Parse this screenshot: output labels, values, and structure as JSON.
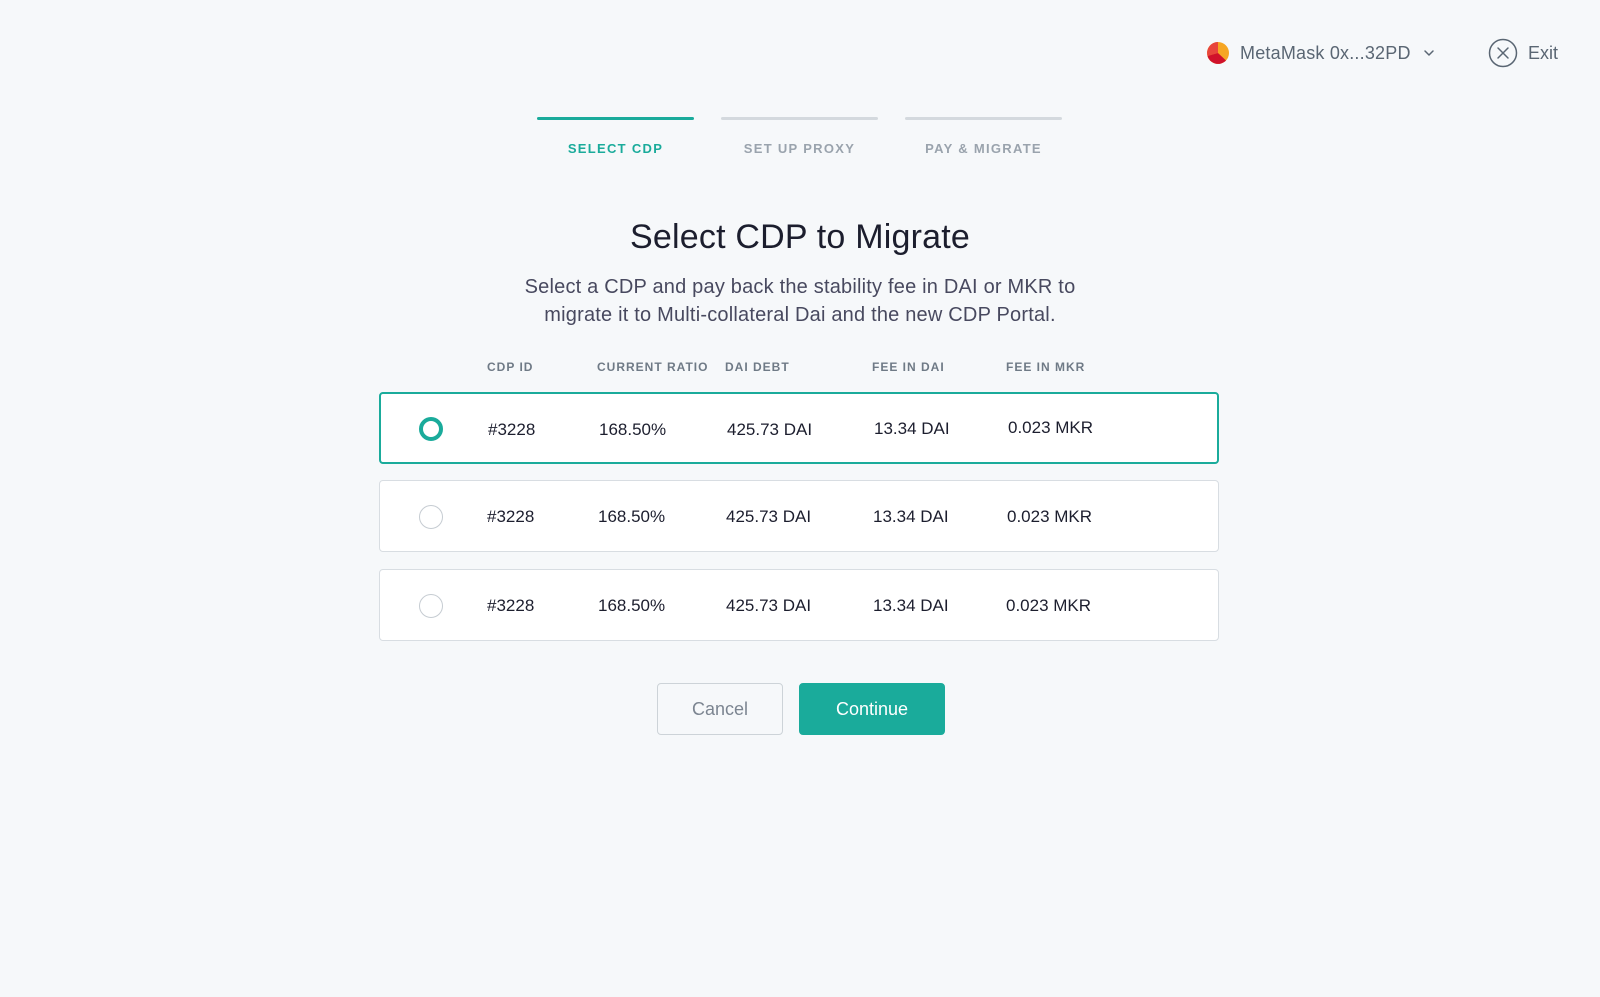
{
  "header": {
    "account_label": "MetaMask 0x...32PD",
    "account_icon": "metamask-logo-icon",
    "exit_label": "Exit",
    "exit_icon": "close-circle-icon"
  },
  "stepper": {
    "steps": [
      {
        "label": "SELECT CDP",
        "active": true
      },
      {
        "label": "SET UP PROXY",
        "active": false
      },
      {
        "label": "PAY & MIGRATE",
        "active": false
      }
    ]
  },
  "main": {
    "title": "Select CDP to Migrate",
    "subtitle": "Select a CDP and pay back the stability fee in DAI or MKR to migrate it to Multi-collateral Dai and the new CDP Portal."
  },
  "table": {
    "columns": [
      "CDP ID",
      "CURRENT RATIO",
      "DAI DEBT",
      "FEE IN DAI",
      "FEE IN MKR"
    ],
    "rows": [
      {
        "id": "#3228",
        "ratio": "168.50%",
        "debt": "425.73 DAI",
        "fee_dai": "13.34 DAI",
        "fee_mkr": "0.023 MKR",
        "selected": true
      },
      {
        "id": "#3228",
        "ratio": "168.50%",
        "debt": "425.73 DAI",
        "fee_dai": "13.34 DAI",
        "fee_mkr": "0.023 MKR",
        "selected": false
      },
      {
        "id": "#3228",
        "ratio": "168.50%",
        "debt": "425.73 DAI",
        "fee_dai": "13.34 DAI",
        "fee_mkr": "0.023 MKR",
        "selected": false
      }
    ]
  },
  "actions": {
    "cancel_label": "Cancel",
    "continue_label": "Continue"
  },
  "colors": {
    "accent": "#1aab9b",
    "background": "#f6f8fa",
    "text": "#1c1e2e",
    "muted": "#9aa3ad"
  }
}
